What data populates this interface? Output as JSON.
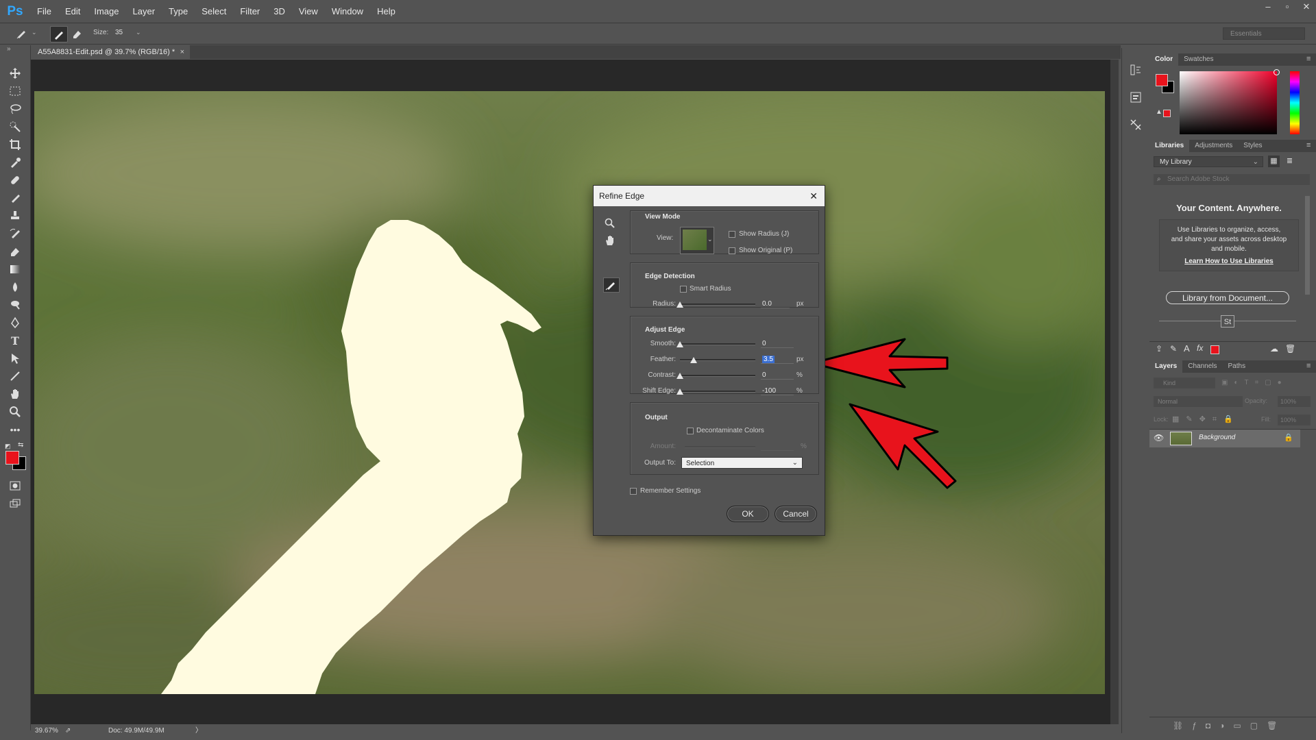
{
  "app": {
    "logo": "Ps"
  },
  "menu": [
    "File",
    "Edit",
    "Image",
    "Layer",
    "Type",
    "Select",
    "Filter",
    "3D",
    "View",
    "Window",
    "Help"
  ],
  "window_controls": [
    "–",
    "▫",
    "✕"
  ],
  "options_bar": {
    "size_label": "Size:",
    "size_value": "35",
    "workspace": "Essentials"
  },
  "document": {
    "tab_title": "A55A8831-Edit.psd @ 39.7% (RGB/16) *",
    "close": "×"
  },
  "status_bar": {
    "zoom": "39.67%",
    "doc_info": "Doc: 49.9M/49.9M",
    "arrow": "〉"
  },
  "colors": {
    "foreground": "#e8131c",
    "background": "#000000",
    "annotation_arrow": "#ff0000",
    "selection_mask": "#fffbe0"
  },
  "dialog": {
    "title": "Refine Edge",
    "close": "✕",
    "view_mode": {
      "title": "View Mode",
      "view_label": "View:",
      "show_radius": "Show Radius (J)",
      "show_original": "Show Original (P)"
    },
    "edge_detection": {
      "title": "Edge Detection",
      "smart_radius": "Smart Radius",
      "radius_label": "Radius:",
      "radius_value": "0.0",
      "radius_unit": "px"
    },
    "adjust_edge": {
      "title": "Adjust Edge",
      "smooth_label": "Smooth:",
      "smooth_value": "0",
      "feather_label": "Feather:",
      "feather_value": "3.5",
      "feather_unit": "px",
      "contrast_label": "Contrast:",
      "contrast_value": "0",
      "contrast_unit": "%",
      "shift_label": "Shift Edge:",
      "shift_value": "-100",
      "shift_unit": "%"
    },
    "output": {
      "title": "Output",
      "decontaminate": "Decontaminate Colors",
      "amount_label": "Amount:",
      "amount_unit": "%",
      "output_to_label": "Output To:",
      "output_to_value": "Selection"
    },
    "remember": "Remember Settings",
    "ok": "OK",
    "cancel": "Cancel"
  },
  "color_panel": {
    "tabs": [
      "Color",
      "Swatches"
    ]
  },
  "libraries_panel": {
    "tabs": [
      "Libraries",
      "Adjustments",
      "Styles"
    ],
    "library_select": "My Library",
    "search_placeholder": "Search Adobe Stock",
    "heading": "Your Content. Anywhere.",
    "body": "Use Libraries to organize, access, and share your assets across desktop and mobile.",
    "link": "Learn How to Use Libraries",
    "button": "Library from Document...",
    "stock_badge": "St"
  },
  "layers_panel": {
    "tabs": [
      "Layers",
      "Channels",
      "Paths"
    ],
    "kind_placeholder": "Kind",
    "blend_mode": "Normal",
    "opacity_label": "Opacity:",
    "opacity_value": "100%",
    "lock_label": "Lock:",
    "fill_label": "Fill:",
    "fill_value": "100%",
    "layers": [
      {
        "name": "Background",
        "visible": true,
        "locked": true
      }
    ]
  }
}
